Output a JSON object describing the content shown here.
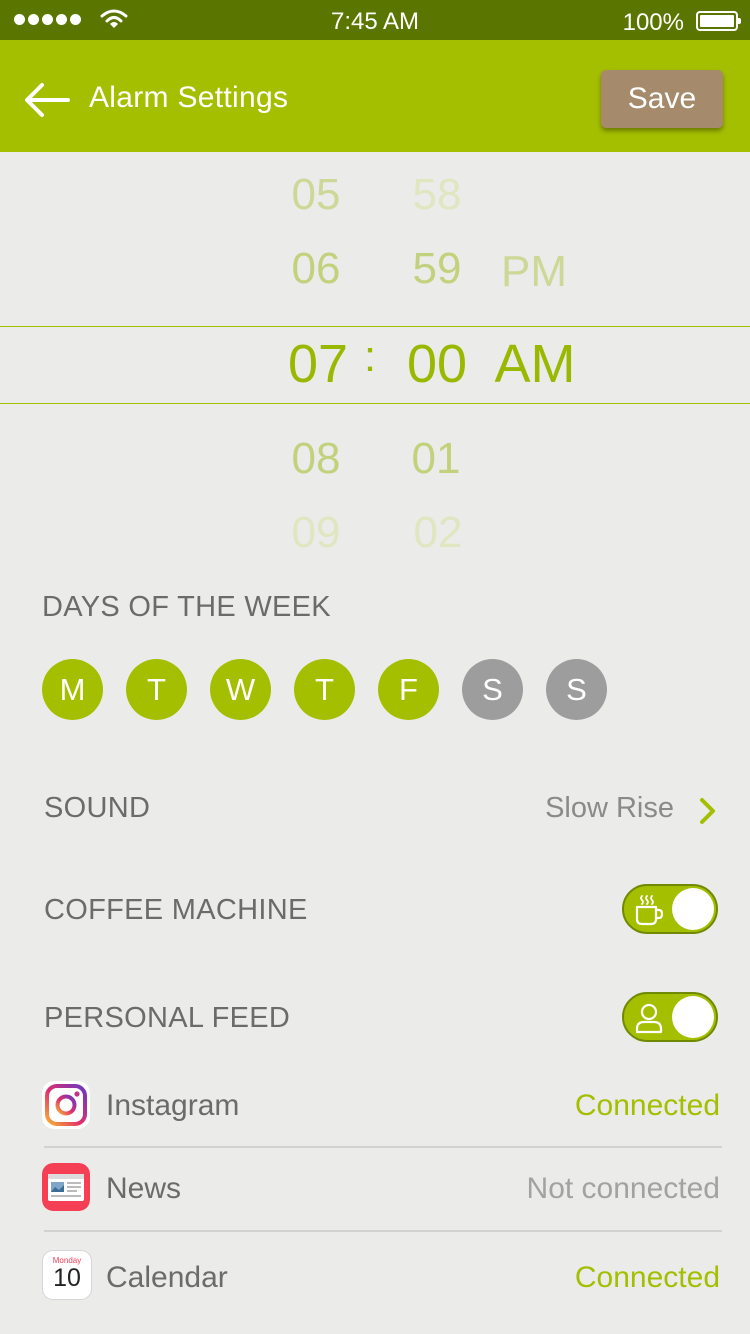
{
  "status_bar": {
    "time": "7:45 AM",
    "battery": "100%"
  },
  "nav": {
    "title": "Alarm Settings",
    "save_label": "Save"
  },
  "picker": {
    "hours": [
      "05",
      "06",
      "07",
      "08",
      "09"
    ],
    "minutes": [
      "58",
      "59",
      "00",
      "01",
      "02"
    ],
    "separator": ":",
    "periods": [
      "PM",
      "AM"
    ],
    "selected": {
      "hour": "07",
      "minute": "00",
      "period": "AM"
    }
  },
  "days": {
    "label": "DAYS OF THE WEEK",
    "items": [
      {
        "letter": "M",
        "active": true
      },
      {
        "letter": "T",
        "active": true
      },
      {
        "letter": "W",
        "active": true
      },
      {
        "letter": "T",
        "active": true
      },
      {
        "letter": "F",
        "active": true
      },
      {
        "letter": "S",
        "active": false
      },
      {
        "letter": "S",
        "active": false
      }
    ]
  },
  "sound": {
    "label": "SOUND",
    "value": "Slow Rise"
  },
  "coffee": {
    "label": "COFFEE MACHINE",
    "enabled": true,
    "icon": "coffee-cup-icon"
  },
  "feed": {
    "label": "PERSONAL FEED",
    "enabled": true,
    "icon": "person-icon",
    "items": [
      {
        "name": "Instagram",
        "status": "Connected",
        "icon": "instagram-icon"
      },
      {
        "name": "News",
        "status": "Not connected",
        "icon": "news-icon"
      },
      {
        "name": "Calendar",
        "status": "Connected",
        "icon": "calendar-icon",
        "icon_day": "Monday",
        "icon_date": "10"
      }
    ]
  },
  "colors": {
    "accent": "#a4bf00",
    "status_bar": "#5a7600",
    "save": "#a58b6b",
    "inactive": "#9d9d9d"
  }
}
